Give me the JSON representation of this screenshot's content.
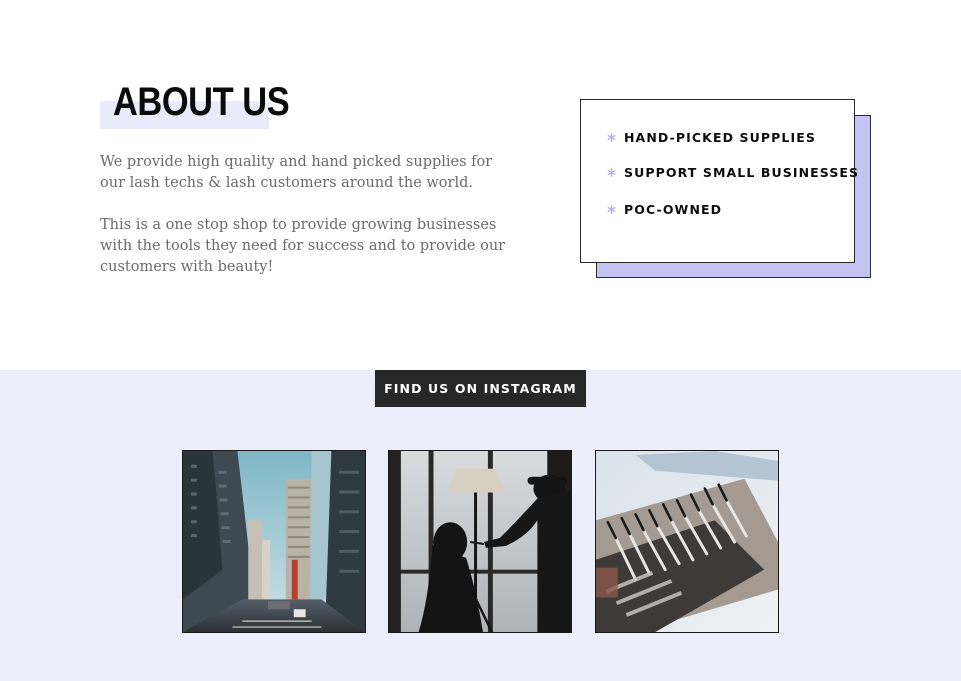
{
  "about": {
    "title": "ABOUT US",
    "paragraph_1": "We provide high quality and hand picked supplies for our lash techs & lash customers around the world.",
    "paragraph_2": "This is a one stop shop to provide growing businesses with the tools they need for success and to provide our customers with beauty!"
  },
  "features": {
    "icon": "asterisk-icon",
    "items": [
      {
        "label": "HAND-PICKED SUPPLIES"
      },
      {
        "label": "SUPPORT SMALL BUSINESSES"
      },
      {
        "label": "POC-OWNED"
      }
    ]
  },
  "instagram": {
    "button_label": "FIND US ON INSTAGRAM",
    "photos": [
      {
        "subject": "city-street-photo"
      },
      {
        "subject": "makeup-artist-silhouette-photo"
      },
      {
        "subject": "makeup-brushes-photo"
      }
    ]
  },
  "colors": {
    "accent_lavender": "#c4c3f4",
    "highlight": "#e9ebfb",
    "section_bg": "#eceefb",
    "button_bg": "#272727",
    "body_text": "#6a6a6a"
  }
}
